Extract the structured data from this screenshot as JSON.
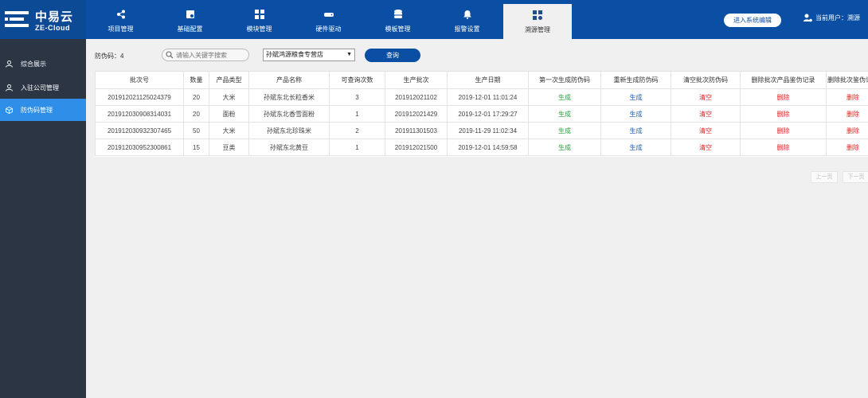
{
  "brand": {
    "name_cn": "中易云",
    "name_en": "ZE-Cloud"
  },
  "nav": [
    {
      "label": "项目管理",
      "icon": "share-nodes-icon"
    },
    {
      "label": "基础配置",
      "icon": "config-card-icon"
    },
    {
      "label": "模块管理",
      "icon": "module-grid-icon"
    },
    {
      "label": "硬件驱动",
      "icon": "hard-drive-icon"
    },
    {
      "label": "模板管理",
      "icon": "database-icon"
    },
    {
      "label": "报警设置",
      "icon": "bell-icon"
    },
    {
      "label": "溯源管理",
      "icon": "apps-gear-icon",
      "active": true
    }
  ],
  "header": {
    "system_button": "进入系统编辑",
    "user_label": "当前用户：溯源"
  },
  "sidebar": [
    {
      "label": "综合展示",
      "icon": "user-icon"
    },
    {
      "label": "入驻公司管理",
      "icon": "user-icon"
    },
    {
      "label": "防伪码管理",
      "icon": "cube-icon",
      "active": true
    }
  ],
  "filter": {
    "count_label": "防伪码：4",
    "search_placeholder": "请输入关键字搜索",
    "select_value": "孙斌鸿源粮食专营店",
    "query_button": "查询"
  },
  "table": {
    "headers": [
      "批次号",
      "数量",
      "产品类型",
      "产品名称",
      "可查询次数",
      "生产批次",
      "生产日期",
      "第一次生成防伪码",
      "重新生成防伪码",
      "清空批次防伪码",
      "删除批次产品鉴伪记录",
      "删除批次鉴伪记录"
    ],
    "rows": [
      [
        "201912021125024379",
        "20",
        "大米",
        "孙斌东北长粒香米",
        "3",
        "201912021102",
        "2019-12-01 11:01:24",
        "生成",
        "生成",
        "清空",
        "删除",
        "删除"
      ],
      [
        "201912030908314031",
        "20",
        "面粉",
        "孙斌东北香雪面粉",
        "1",
        "201912021429",
        "2019-12-01 17:29:27",
        "生成",
        "生成",
        "清空",
        "删除",
        "删除"
      ],
      [
        "201912030932307465",
        "50",
        "大米",
        "孙斌东北珍珠米",
        "2",
        "201911301503",
        "2019-11-29 11:02:34",
        "生成",
        "生成",
        "清空",
        "删除",
        "删除"
      ],
      [
        "201912030952300861",
        "15",
        "豆类",
        "孙斌东北黄豆",
        "1",
        "201912021500",
        "2019-12-01 14:59:58",
        "生成",
        "生成",
        "清空",
        "删除",
        "删除"
      ]
    ]
  },
  "pager": {
    "prev": "上一页",
    "next": "下一页"
  },
  "colors": {
    "primary": "#0a4fa3",
    "sidebar": "#2b3544",
    "sidebar_active": "#2e8ee8",
    "green": "#2a9d3c",
    "blue": "#1e5fb3",
    "red": "#e02020"
  }
}
